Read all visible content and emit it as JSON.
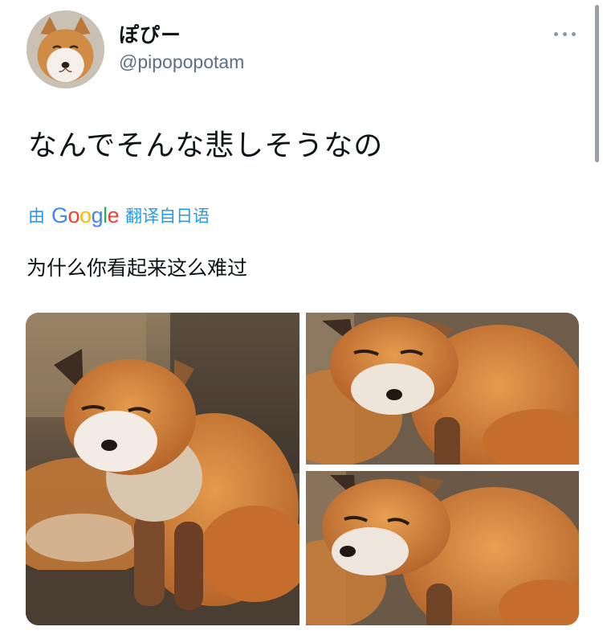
{
  "tweet": {
    "author": {
      "display_name": "ぽぴー",
      "handle": "@pipopopotam",
      "avatar_icon": "fox-face-avatar"
    },
    "text": "なんでそんな悲しそうなの",
    "translation": {
      "by_label": "由",
      "provider": "Google",
      "source_label": "翻译自日语",
      "text": "为什么你看起来这么难过"
    },
    "more_icon": "more-horizontal-icon",
    "media": [
      {
        "subject": "fox-photo"
      },
      {
        "subject": "fox-photo"
      },
      {
        "subject": "fox-photo"
      }
    ]
  },
  "colors": {
    "link": "#1d9bf0",
    "secondary_text": "#5b7083",
    "primary_text": "#0f1419",
    "google_blue": "#4285F4",
    "google_red": "#EA4335",
    "google_yellow": "#FBBC05",
    "google_green": "#34A853"
  }
}
